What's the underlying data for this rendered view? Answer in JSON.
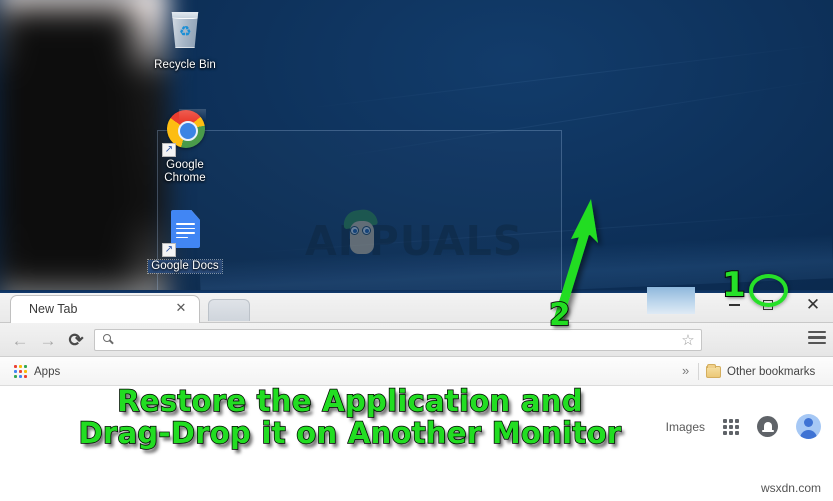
{
  "desktop": {
    "icons": [
      {
        "name": "recycle-bin",
        "label": "Recycle Bin",
        "selected": false
      },
      {
        "name": "google-chrome",
        "label": "Google\nChrome",
        "label_line1": "Google",
        "label_line2": "Chrome",
        "selected": false
      },
      {
        "name": "google-docs",
        "label": "Google Docs",
        "selected": true
      }
    ],
    "watermark": "APPUALS",
    "background_color": "#0c2d54"
  },
  "browser": {
    "tab": {
      "title": "New Tab",
      "close_icon": "close-icon"
    },
    "new_tab_button_icon": "new-tab-icon",
    "window_controls": {
      "minimize_label": "—",
      "maximize_label": "□",
      "close_label": "✕"
    },
    "toolbar": {
      "back_icon": "←",
      "forward_icon": "→",
      "reload_icon": "⟳",
      "omnibox_placeholder": "",
      "omnibox_value": "",
      "search_icon": "search-icon",
      "star_icon": "☆",
      "menu_icon": "hamburger-menu-icon"
    },
    "bookmarks": {
      "apps_label": "Apps",
      "overflow_label": "»",
      "other_bookmarks_label": "Other bookmarks"
    },
    "page": {
      "images_link": "Images",
      "apps_grid_icon": "google-apps-grid-icon",
      "notifications_icon": "notifications-bell-icon",
      "avatar_icon": "user-avatar-icon"
    }
  },
  "annotations": {
    "line1": "Restore the Application and",
    "line2": "Drag-Drop it on Another Monitor",
    "step1_number": "1",
    "step2_number": "2",
    "highlight_color": "#22dd22",
    "circle_target": "maximize-restore-button"
  },
  "watermark": "wsxdn.com"
}
